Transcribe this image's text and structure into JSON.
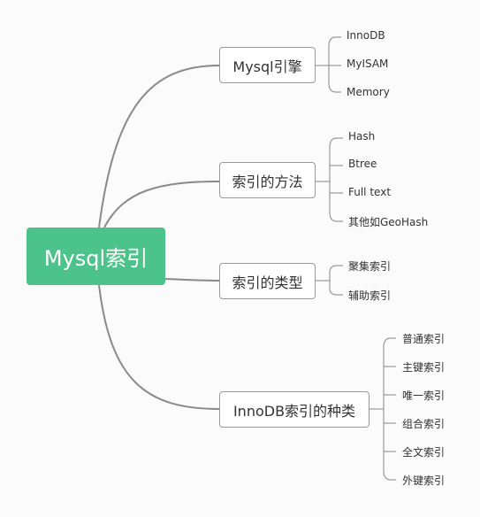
{
  "root": "Mysql索引",
  "branches": [
    {
      "label": "Mysql引擎",
      "leaves": [
        "InnoDB",
        "MyISAM",
        "Memory"
      ]
    },
    {
      "label": "索引的方法",
      "leaves": [
        "Hash",
        "Btree",
        "Full text",
        "其他如GeoHash"
      ]
    },
    {
      "label": "索引的类型",
      "leaves": [
        "聚集索引",
        "辅助索引"
      ]
    },
    {
      "label": "InnoDB索引的种类",
      "leaves": [
        "普通索引",
        "主键索引",
        "唯一索引",
        "组合索引",
        "全文索引",
        "外键索引"
      ]
    }
  ],
  "colors": {
    "root_fill": "#4cc38a",
    "line": "#888888"
  }
}
